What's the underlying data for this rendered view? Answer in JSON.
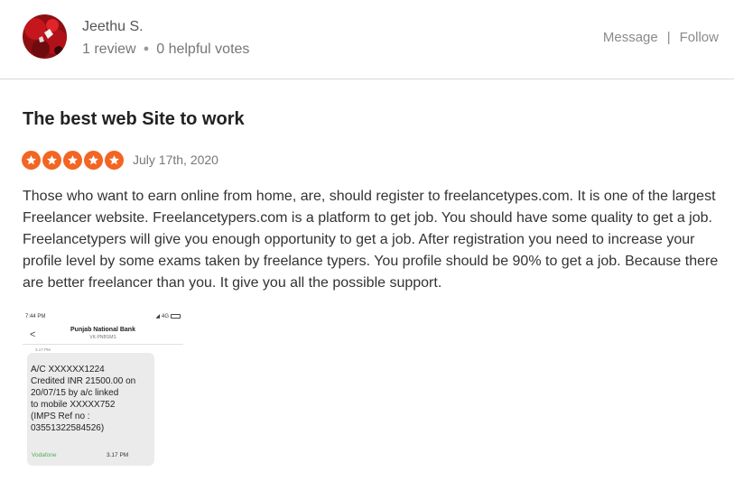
{
  "user": {
    "name": "Jeethu S.",
    "reviews": "1 review",
    "helpful_votes": "0 helpful votes"
  },
  "actions": {
    "message": "Message",
    "separator": "|",
    "follow": "Follow"
  },
  "review": {
    "title": "The best web Site to work",
    "rating": 5,
    "rating_max": 5,
    "date": "July 17th, 2020",
    "text": "Those who want to earn online from home, are, should register to freelancetypes.com. It is one of the largest Freelancer website. Freelancetypers.com is a platform to get job. You should have some quality to get a job. Freelancetypers will give you enough opportunity to get a job. After registration you need to increase your profile level by some exams taken by freelance typers. You profile should be 90% to get a job. Because there are better freelancer than you. It give you all the possible support."
  },
  "attachment": {
    "status_time": "7:44 PM",
    "status_signal": "4G",
    "sender": "Punjab National Bank",
    "sender_code": "VK-PNBSMS",
    "message_stamp": "3.17 PM",
    "message": "A/C XXXXXX1224\nCredited INR 21500.00 on\n20/07/15 by a/c linked\nto mobile XXXXX752\n(IMPS Ref no :\n03551322584526)",
    "carrier": "Vodafone",
    "message_time": "3.17 PM"
  },
  "colors": {
    "star": "#f26522",
    "title": "#222222",
    "muted": "#777777"
  }
}
